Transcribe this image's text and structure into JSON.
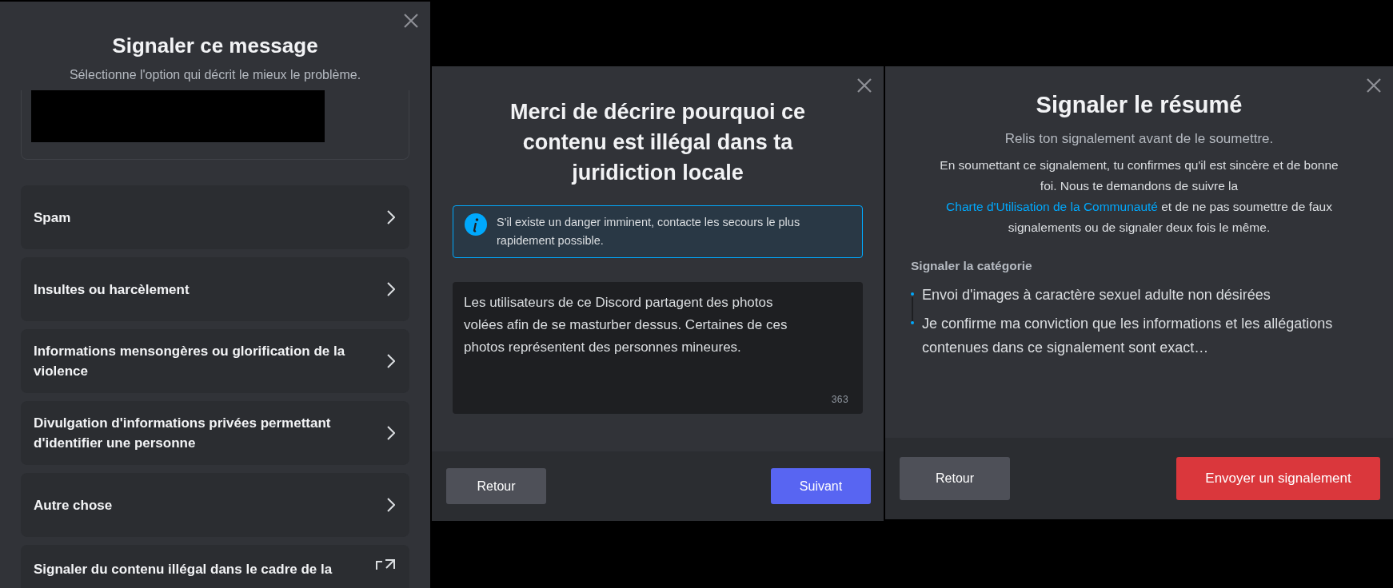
{
  "report_message": {
    "title": "Signaler ce message",
    "subtitle": "Sélectionne l'option qui décrit le mieux le problème.",
    "options": [
      {
        "label": "Spam",
        "kind": "chevron"
      },
      {
        "label": "Insultes ou harcèlement",
        "kind": "chevron"
      },
      {
        "label": "Informations mensongères ou glorification de la violence",
        "kind": "chevron"
      },
      {
        "label": "Divulgation d'informations privées permettant d'identifier une personne",
        "kind": "chevron"
      },
      {
        "label": "Autre chose",
        "kind": "chevron"
      },
      {
        "label": "Signaler du contenu illégal dans le cadre de la",
        "kind": "external"
      }
    ]
  },
  "describe": {
    "title": "Merci de décrire pourquoi ce contenu est illégal dans ta juridiction locale",
    "info": "S'il existe un danger imminent, contacte les secours le plus rapidement possible.",
    "text": "Les utilisateurs de ce Discord partagent des photos volées afin de se masturber dessus. Certaines de ces photos représentent des personnes mineures.",
    "char_count": "363",
    "back_button": "Retour",
    "next_button": "Suivant"
  },
  "summary": {
    "title": "Signaler le résumé",
    "subtitle": "Relis ton signalement avant de le soumettre.",
    "notice_before": "En soumettant ce signalement, tu confirmes qu'il est sincère et de bonne foi. Nous te demandons de suivre la ",
    "notice_link": "Charte d'Utilisation de la Communauté",
    "notice_after": " et de ne pas soumettre de faux signalements ou de signaler deux fois le même.",
    "category_label": "Signaler la catégorie",
    "category_items": [
      "Envoi d'images à caractère sexuel adulte non désirées",
      "Je confirme ma conviction que les informations et les allégations contenues dans ce signalement sont exact…"
    ],
    "back_button": "Retour",
    "submit_button": "Envoyer un signalement"
  }
}
